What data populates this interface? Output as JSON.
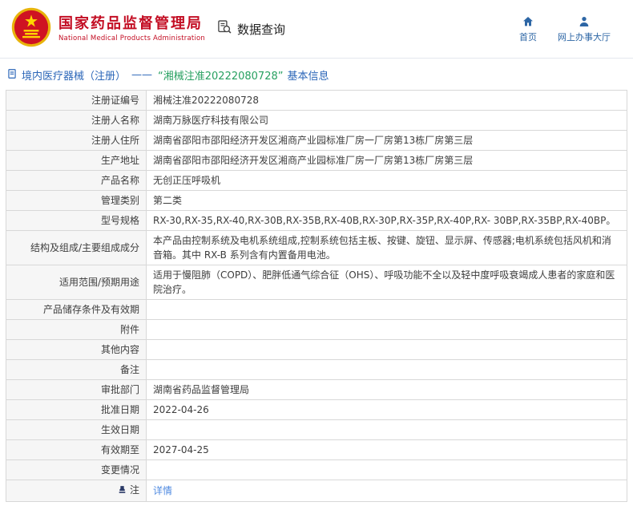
{
  "colors": {
    "brand_red": "#c30d23",
    "nav_blue": "#2d66a5",
    "breadcrumb_blue": "#2b66b8",
    "cert_green": "#27a060",
    "link_blue": "#4f8ae0",
    "table_border": "#d8d8d8",
    "label_bg": "#f6f6f6"
  },
  "icons": {
    "brand": "national-emblem-icon",
    "section": "document-search-icon",
    "home": "home-icon",
    "online_hall": "person-icon",
    "breadcrumb": "document-icon",
    "note": "seal-icon"
  },
  "header": {
    "org_name_cn": "国家药品监督管理局",
    "org_name_en": "National Medical Products Administration",
    "section_title": "数据查询",
    "nav": [
      {
        "label": "首页"
      },
      {
        "label": "网上办事大厅"
      }
    ]
  },
  "breadcrumb": {
    "prefix": "境内医疗器械（注册）",
    "dash": "——",
    "highlight": "“湘械注准20222080728”",
    "suffix": "基本信息"
  },
  "table": {
    "rows": [
      {
        "label": "注册证编号",
        "value": "湘械注准20222080728"
      },
      {
        "label": "注册人名称",
        "value": "湖南万脉医疗科技有限公司"
      },
      {
        "label": "注册人住所",
        "value": "湖南省邵阳市邵阳经济开发区湘商产业园标准厂房一厂房第13栋厂房第三层"
      },
      {
        "label": "生产地址",
        "value": "湖南省邵阳市邵阳经济开发区湘商产业园标准厂房一厂房第13栋厂房第三层"
      },
      {
        "label": "产品名称",
        "value": "无创正压呼吸机"
      },
      {
        "label": "管理类别",
        "value": "第二类"
      },
      {
        "label": "型号规格",
        "value": "RX-30,RX-35,RX-40,RX-30B,RX-35B,RX-40B,RX-30P,RX-35P,RX-40P,RX- 30BP,RX-35BP,RX-40BP。"
      },
      {
        "label": "结构及组成/主要组成成分",
        "value": "本产品由控制系统及电机系统组成,控制系统包括主板、按键、旋钮、显示屏、传感器;电机系统包括风机和消音箱。其中 RX-B 系列含有内置备用电池。"
      },
      {
        "label": "适用范围/预期用途",
        "value": "适用于慢阻肺（COPD）、肥胖低通气综合征（OHS）、呼吸功能不全以及轻中度呼吸衰竭成人患者的家庭和医院治疗。"
      },
      {
        "label": "产品储存条件及有效期",
        "value": ""
      },
      {
        "label": "附件",
        "value": ""
      },
      {
        "label": "其他内容",
        "value": ""
      },
      {
        "label": "备注",
        "value": ""
      },
      {
        "label": "审批部门",
        "value": "湖南省药品监督管理局"
      },
      {
        "label": "批准日期",
        "value": "2022-04-26"
      },
      {
        "label": "生效日期",
        "value": ""
      },
      {
        "label": "有效期至",
        "value": "2027-04-25"
      },
      {
        "label": "变更情况",
        "value": ""
      }
    ],
    "note_row": {
      "label": "注",
      "link_label": "详情"
    }
  }
}
